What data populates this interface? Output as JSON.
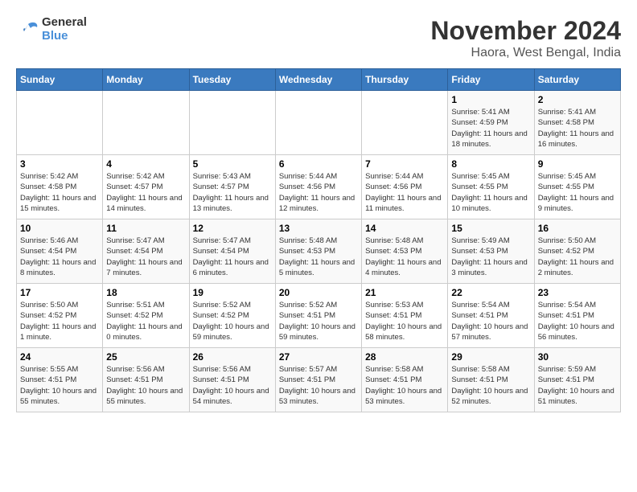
{
  "header": {
    "logo_general": "General",
    "logo_blue": "Blue",
    "title": "November 2024",
    "subtitle": "Haora, West Bengal, India"
  },
  "days_of_week": [
    "Sunday",
    "Monday",
    "Tuesday",
    "Wednesday",
    "Thursday",
    "Friday",
    "Saturday"
  ],
  "weeks": [
    [
      {
        "day": "",
        "info": ""
      },
      {
        "day": "",
        "info": ""
      },
      {
        "day": "",
        "info": ""
      },
      {
        "day": "",
        "info": ""
      },
      {
        "day": "",
        "info": ""
      },
      {
        "day": "1",
        "info": "Sunrise: 5:41 AM\nSunset: 4:59 PM\nDaylight: 11 hours and 18 minutes."
      },
      {
        "day": "2",
        "info": "Sunrise: 5:41 AM\nSunset: 4:58 PM\nDaylight: 11 hours and 16 minutes."
      }
    ],
    [
      {
        "day": "3",
        "info": "Sunrise: 5:42 AM\nSunset: 4:58 PM\nDaylight: 11 hours and 15 minutes."
      },
      {
        "day": "4",
        "info": "Sunrise: 5:42 AM\nSunset: 4:57 PM\nDaylight: 11 hours and 14 minutes."
      },
      {
        "day": "5",
        "info": "Sunrise: 5:43 AM\nSunset: 4:57 PM\nDaylight: 11 hours and 13 minutes."
      },
      {
        "day": "6",
        "info": "Sunrise: 5:44 AM\nSunset: 4:56 PM\nDaylight: 11 hours and 12 minutes."
      },
      {
        "day": "7",
        "info": "Sunrise: 5:44 AM\nSunset: 4:56 PM\nDaylight: 11 hours and 11 minutes."
      },
      {
        "day": "8",
        "info": "Sunrise: 5:45 AM\nSunset: 4:55 PM\nDaylight: 11 hours and 10 minutes."
      },
      {
        "day": "9",
        "info": "Sunrise: 5:45 AM\nSunset: 4:55 PM\nDaylight: 11 hours and 9 minutes."
      }
    ],
    [
      {
        "day": "10",
        "info": "Sunrise: 5:46 AM\nSunset: 4:54 PM\nDaylight: 11 hours and 8 minutes."
      },
      {
        "day": "11",
        "info": "Sunrise: 5:47 AM\nSunset: 4:54 PM\nDaylight: 11 hours and 7 minutes."
      },
      {
        "day": "12",
        "info": "Sunrise: 5:47 AM\nSunset: 4:54 PM\nDaylight: 11 hours and 6 minutes."
      },
      {
        "day": "13",
        "info": "Sunrise: 5:48 AM\nSunset: 4:53 PM\nDaylight: 11 hours and 5 minutes."
      },
      {
        "day": "14",
        "info": "Sunrise: 5:48 AM\nSunset: 4:53 PM\nDaylight: 11 hours and 4 minutes."
      },
      {
        "day": "15",
        "info": "Sunrise: 5:49 AM\nSunset: 4:53 PM\nDaylight: 11 hours and 3 minutes."
      },
      {
        "day": "16",
        "info": "Sunrise: 5:50 AM\nSunset: 4:52 PM\nDaylight: 11 hours and 2 minutes."
      }
    ],
    [
      {
        "day": "17",
        "info": "Sunrise: 5:50 AM\nSunset: 4:52 PM\nDaylight: 11 hours and 1 minute."
      },
      {
        "day": "18",
        "info": "Sunrise: 5:51 AM\nSunset: 4:52 PM\nDaylight: 11 hours and 0 minutes."
      },
      {
        "day": "19",
        "info": "Sunrise: 5:52 AM\nSunset: 4:52 PM\nDaylight: 10 hours and 59 minutes."
      },
      {
        "day": "20",
        "info": "Sunrise: 5:52 AM\nSunset: 4:51 PM\nDaylight: 10 hours and 59 minutes."
      },
      {
        "day": "21",
        "info": "Sunrise: 5:53 AM\nSunset: 4:51 PM\nDaylight: 10 hours and 58 minutes."
      },
      {
        "day": "22",
        "info": "Sunrise: 5:54 AM\nSunset: 4:51 PM\nDaylight: 10 hours and 57 minutes."
      },
      {
        "day": "23",
        "info": "Sunrise: 5:54 AM\nSunset: 4:51 PM\nDaylight: 10 hours and 56 minutes."
      }
    ],
    [
      {
        "day": "24",
        "info": "Sunrise: 5:55 AM\nSunset: 4:51 PM\nDaylight: 10 hours and 55 minutes."
      },
      {
        "day": "25",
        "info": "Sunrise: 5:56 AM\nSunset: 4:51 PM\nDaylight: 10 hours and 55 minutes."
      },
      {
        "day": "26",
        "info": "Sunrise: 5:56 AM\nSunset: 4:51 PM\nDaylight: 10 hours and 54 minutes."
      },
      {
        "day": "27",
        "info": "Sunrise: 5:57 AM\nSunset: 4:51 PM\nDaylight: 10 hours and 53 minutes."
      },
      {
        "day": "28",
        "info": "Sunrise: 5:58 AM\nSunset: 4:51 PM\nDaylight: 10 hours and 53 minutes."
      },
      {
        "day": "29",
        "info": "Sunrise: 5:58 AM\nSunset: 4:51 PM\nDaylight: 10 hours and 52 minutes."
      },
      {
        "day": "30",
        "info": "Sunrise: 5:59 AM\nSunset: 4:51 PM\nDaylight: 10 hours and 51 minutes."
      }
    ]
  ]
}
